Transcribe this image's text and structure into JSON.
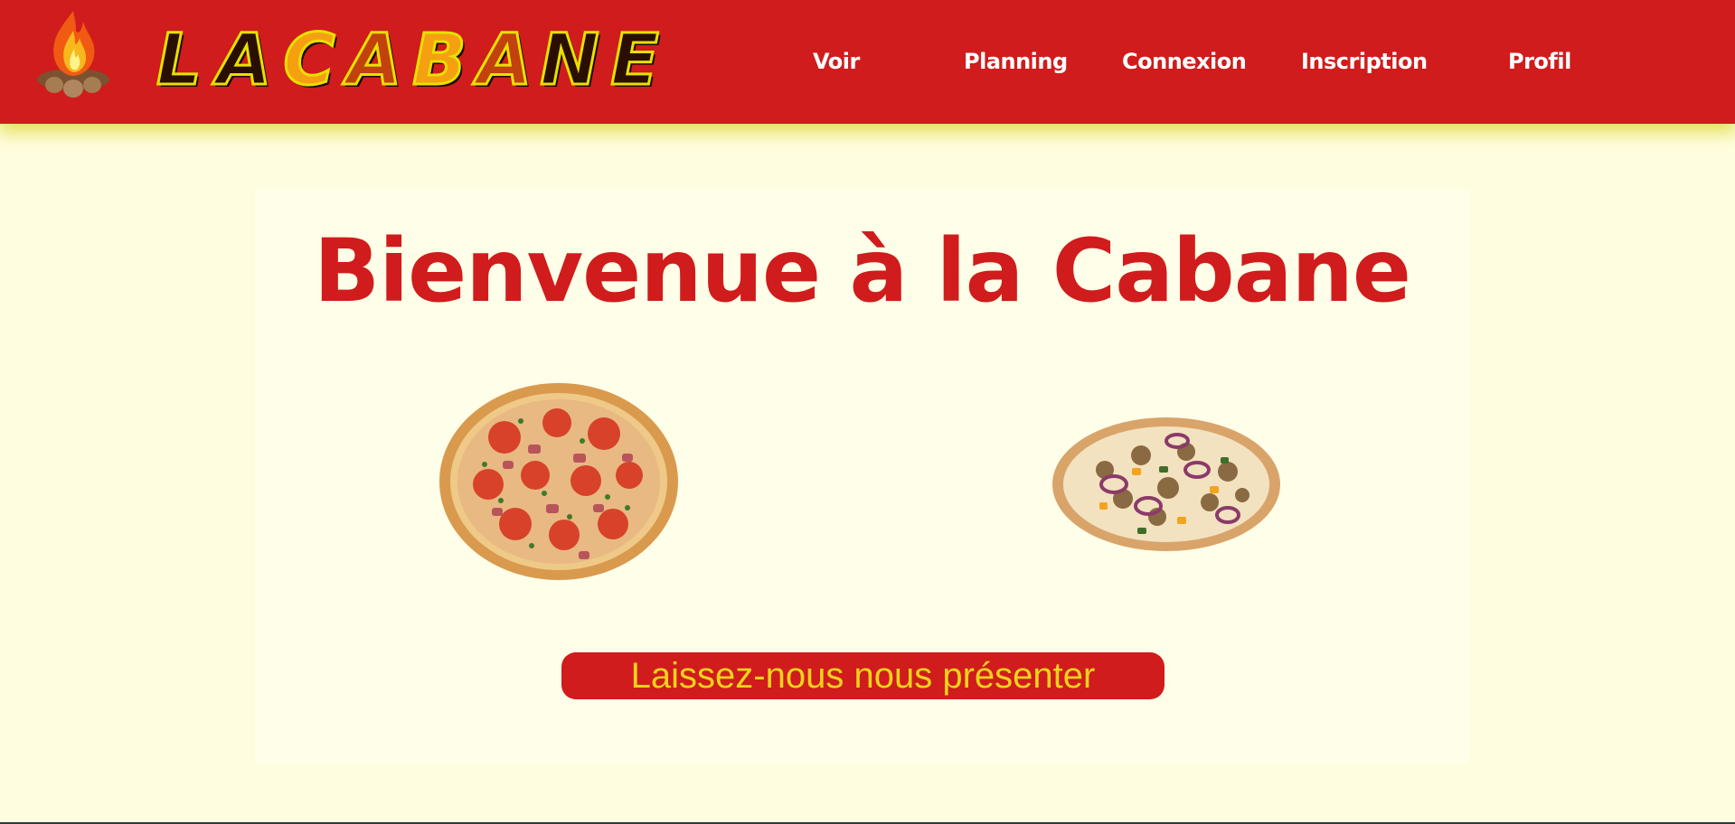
{
  "header": {
    "logo_text": [
      "L",
      "A",
      "C",
      "A",
      "B",
      "A",
      "N",
      "E"
    ],
    "logo_icon": "campfire-icon",
    "nav": [
      {
        "label": "Voir"
      },
      {
        "label": "Planning"
      },
      {
        "label": "Connexion"
      },
      {
        "label": "Inscription"
      },
      {
        "label": "Profil"
      }
    ]
  },
  "main": {
    "title": "Bienvenue à la Cabane",
    "images": [
      "pizza-tomato-ham",
      "pizza-onion-chicken"
    ],
    "cta_label": "Laissez-nous nous présenter"
  },
  "colors": {
    "brand_red": "#d01c1c",
    "background": "#fffde0",
    "card": "#fffee8",
    "accent_yellow": "#f0d21c"
  }
}
